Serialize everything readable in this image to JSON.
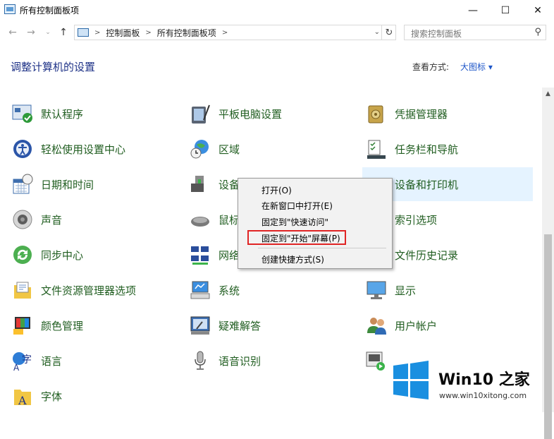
{
  "window": {
    "title": "所有控制面板项",
    "minimize_glyph": "—",
    "maximize_glyph": "☐",
    "close_glyph": "✕"
  },
  "addressbar": {
    "crumbs": [
      "控制面板",
      "所有控制面板项"
    ],
    "search_placeholder": "搜索控制面板"
  },
  "header": {
    "heading": "调整计算机的设置",
    "view_by_label": "查看方式:",
    "view_by_value": "大图标 ▾"
  },
  "items": [
    {
      "label": "默认程序",
      "icon": "default-programs-icon"
    },
    {
      "label": "平板电脑设置",
      "icon": "tablet-icon"
    },
    {
      "label": "凭据管理器",
      "icon": "credential-vault-icon"
    },
    {
      "label": "轻松使用设置中心",
      "icon": "ease-of-access-icon"
    },
    {
      "label": "区域",
      "icon": "globe-clock-icon"
    },
    {
      "label": "任务栏和导航",
      "icon": "taskbar-icon"
    },
    {
      "label": "日期和时间",
      "icon": "calendar-clock-icon"
    },
    {
      "label": "设备",
      "icon": "device-icon"
    },
    {
      "label": "设备和打印机",
      "icon": "printer-icon"
    },
    {
      "label": "声音",
      "icon": "speaker-icon"
    },
    {
      "label": "鼠标",
      "icon": "mouse-icon"
    },
    {
      "label": "索引选项",
      "icon": "index-icon"
    },
    {
      "label": "同步中心",
      "icon": "sync-icon"
    },
    {
      "label": "网络",
      "icon": "network-icon"
    },
    {
      "label": "文件历史记录",
      "icon": "file-history-icon"
    },
    {
      "label": "文件资源管理器选项",
      "icon": "folder-options-icon"
    },
    {
      "label": "系统",
      "icon": "system-icon"
    },
    {
      "label": "显示",
      "icon": "display-icon"
    },
    {
      "label": "颜色管理",
      "icon": "color-management-icon"
    },
    {
      "label": "疑难解答",
      "icon": "troubleshooting-icon"
    },
    {
      "label": "用户帐户",
      "icon": "user-accounts-icon"
    },
    {
      "label": "语言",
      "icon": "language-icon"
    },
    {
      "label": "语音识别",
      "icon": "microphone-icon"
    },
    {
      "label": "",
      "icon": "media-icon"
    },
    {
      "label": "字体",
      "icon": "fonts-icon"
    }
  ],
  "context_menu": {
    "items": [
      "打开(O)",
      "在新窗口中打开(E)",
      "固定到\"快速访问\"",
      "固定到\"开始\"屏幕(P)",
      "创建快捷方式(S)"
    ]
  },
  "watermark": {
    "brand": "Win10 之家",
    "url": "www.win10xitong.com"
  },
  "colors": {
    "link_green": "#215e21",
    "heading_blue": "#1e3287",
    "highlight_red": "#e02424",
    "logo_blue": "#1a8fe0"
  }
}
